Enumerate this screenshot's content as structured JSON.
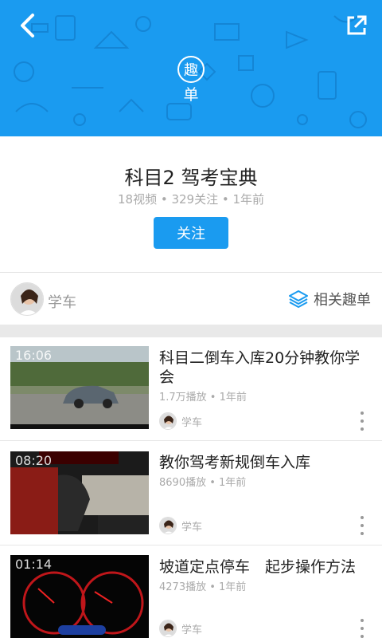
{
  "header": {
    "badge_char": "趣",
    "badge_sub": "单",
    "back_icon": "chevron-left-icon",
    "share_icon": "external-share-icon",
    "color": "#1a9bf0"
  },
  "playlist": {
    "title": "科目2 驾考宝典",
    "stats": "18视频 • 329关注 • 1年前",
    "follow_label": "关注"
  },
  "author": {
    "name": "学车",
    "related_label": "相关趣单",
    "related_icon": "layers-icon"
  },
  "videos": [
    {
      "duration": "16:06",
      "title": "科目二倒车入库20分钟教你学会",
      "meta": "1.7万播放 • 1年前",
      "author": "学车"
    },
    {
      "duration": "08:20",
      "title": "教你驾考新规倒车入库",
      "meta": "8690播放 • 1年前",
      "author": "学车"
    },
    {
      "duration": "01:14",
      "title": "坡道定点停车　起步操作方法",
      "meta": "4273播放 • 1年前",
      "author": "学车"
    }
  ]
}
